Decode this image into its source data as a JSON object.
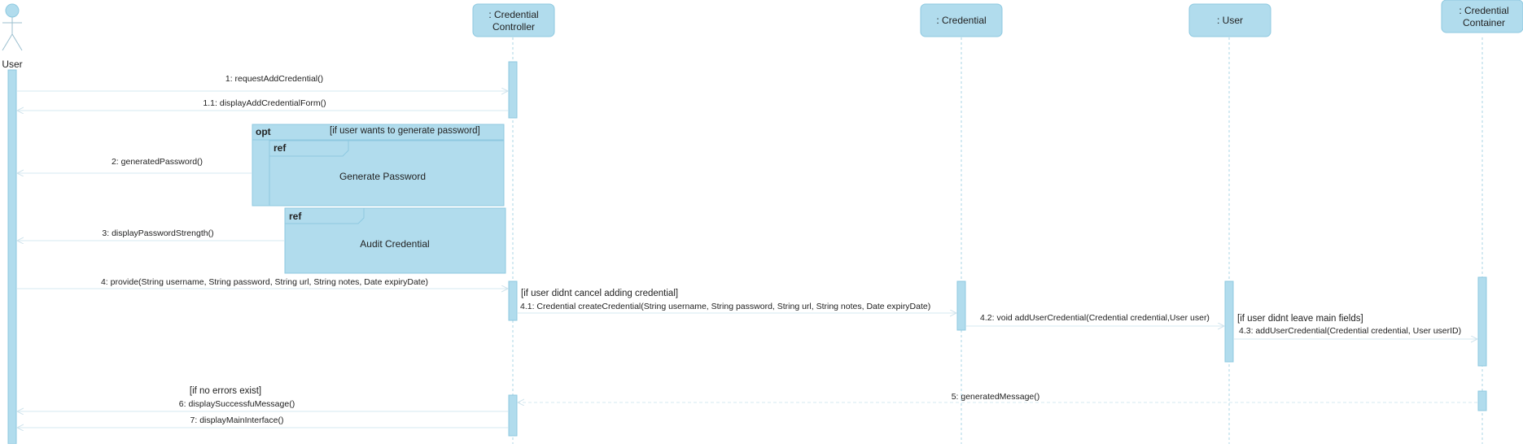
{
  "actor": {
    "label": "User"
  },
  "lifelines": [
    {
      "id": "controller",
      "lines": [
        ": Credential",
        "Controller"
      ]
    },
    {
      "id": "credential",
      "lines": [
        ": Credential"
      ]
    },
    {
      "id": "user",
      "lines": [
        ": User"
      ]
    },
    {
      "id": "container",
      "lines": [
        ": Credential",
        "Container"
      ]
    }
  ],
  "messages": {
    "m1": "1: requestAddCredential()",
    "m1_1": "1.1: displayAddCredentialForm()",
    "m2": "2: generatedPassword()",
    "m3": "3: displayPasswordStrength()",
    "m4": "4: provide(String username, String password, String url, String notes, Date expiryDate)",
    "m4_1": "4.1: Credential createCredential(String username, String password, String url, String notes, Date expiryDate)",
    "m4_2": "4.2: void addUserCredential(Credential credential,User user)",
    "m4_3": "4.3: addUserCredential(Credential credential, User userID)",
    "m5": "5: generatedMessage()",
    "m6": "6: displaySuccessfuMessage()",
    "m7": "7: displayMainInterface()"
  },
  "guards": {
    "g4_1": "[if user didnt cancel adding credential]",
    "g4_3": "[if user didnt leave main fields]",
    "g6": "[if no errors exist]"
  },
  "fragments": {
    "opt": {
      "keyword": "opt",
      "guard": "[if user wants to generate password]"
    },
    "ref1": {
      "keyword": "ref",
      "name": "Generate Password"
    },
    "ref2": {
      "keyword": "ref",
      "name": "Audit Credential"
    }
  },
  "colors": {
    "fill": "#b1dced",
    "stroke": "#8ec9e0",
    "lifeline": "#a8d4e6",
    "arrow": "#d6e8f0",
    "text": "#222222"
  }
}
